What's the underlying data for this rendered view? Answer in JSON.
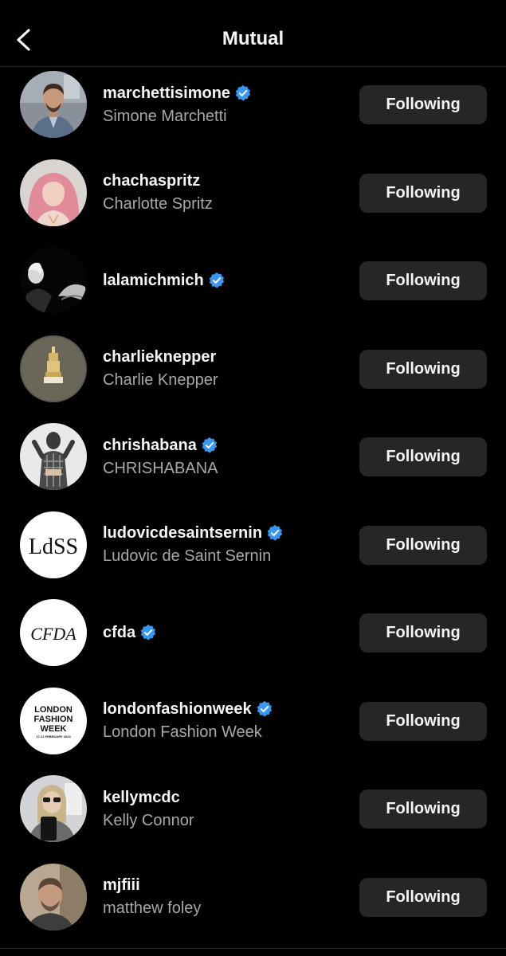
{
  "header": {
    "title": "Mutual",
    "back_icon": "chevron-left-icon"
  },
  "colors": {
    "background": "#000000",
    "button_bg": "#262626",
    "primary_text": "#f5f5f5",
    "secondary_text": "#a8a8a8",
    "verified_blue": "#3897f0"
  },
  "users": [
    {
      "username": "marchettisimone",
      "fullname": "Simone Marchetti",
      "verified": true,
      "button": "Following",
      "avatar": "photo"
    },
    {
      "username": "chachaspritz",
      "fullname": "Charlotte Spritz",
      "verified": false,
      "button": "Following",
      "avatar": "photo"
    },
    {
      "username": "lalamichmich",
      "fullname": "",
      "verified": true,
      "button": "Following",
      "avatar": "photo"
    },
    {
      "username": "charlieknepper",
      "fullname": "Charlie Knepper",
      "verified": false,
      "button": "Following",
      "avatar": "photo"
    },
    {
      "username": "chrishabana",
      "fullname": "CHRISHABANA",
      "verified": true,
      "button": "Following",
      "avatar": "photo"
    },
    {
      "username": "ludovicdesaintsernin",
      "fullname": "Ludovic de Saint Sernin",
      "verified": true,
      "button": "Following",
      "avatar": "logo",
      "logo_text": "LdSS"
    },
    {
      "username": "cfda",
      "fullname": "",
      "verified": true,
      "button": "Following",
      "avatar": "logo",
      "logo_text": "CFDA"
    },
    {
      "username": "londonfashionweek",
      "fullname": "London Fashion Week",
      "verified": true,
      "button": "Following",
      "avatar": "logo",
      "logo_lines": [
        "LONDON",
        "FASHION",
        "WEEK",
        "17-21 FEBRUARY 2023"
      ]
    },
    {
      "username": "kellymcdc",
      "fullname": "Kelly Connor",
      "verified": false,
      "button": "Following",
      "avatar": "photo"
    },
    {
      "username": "mjfiii",
      "fullname": "matthew foley",
      "verified": false,
      "button": "Following",
      "avatar": "photo"
    }
  ]
}
